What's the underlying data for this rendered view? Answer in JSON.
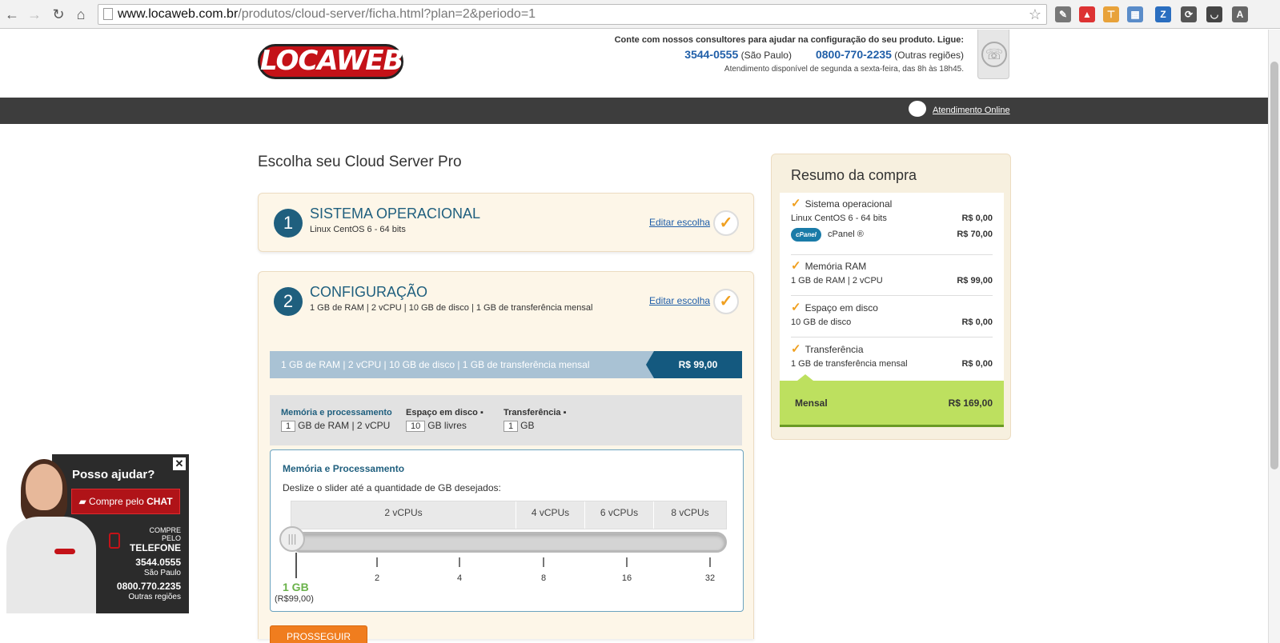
{
  "browser": {
    "url_host": "www.locaweb.com.br",
    "url_path": "/produtos/cloud-server/ficha.html?plan=2&periodo=1"
  },
  "header": {
    "logo": "LOCAWEB",
    "contact_lead": "Conte com nossos consultores para ajudar na configuração do seu produto. Ligue:",
    "phone1": "3544-0555",
    "phone1_region": "(São Paulo)",
    "phone2": "0800-770-2235",
    "phone2_region": "(Outras regiões)",
    "hours": "Atendimento disponível de segunda a sexta-feira, das 8h às 18h45."
  },
  "navbar": {
    "online_support": "Atendimento Online"
  },
  "main": {
    "page_title": "Escolha seu Cloud Server Pro",
    "steps": [
      {
        "num": "1",
        "title": "SISTEMA OPERACIONAL",
        "sub": "Linux CentOS 6 - 64 bits",
        "edit": "Editar escolha"
      },
      {
        "num": "2",
        "title": "CONFIGURAÇÃO",
        "sub": "1 GB de RAM | 2 vCPU | 10 GB de disco | 1 GB de transferência mensal",
        "edit": "Editar escolha"
      }
    ],
    "config_bar": {
      "text": "1 GB de RAM | 2 vCPU | 10 GB de disco | 1 GB de transferência mensal",
      "price": "R$ 99,00"
    },
    "tabs": [
      {
        "head": "Memória e processamento",
        "box": "1",
        "val": "GB de RAM | 2 vCPU"
      },
      {
        "head": "Espaço em disco",
        "box": "10",
        "val": "GB livres"
      },
      {
        "head": "Transferência",
        "box": "1",
        "val": "GB"
      }
    ],
    "memory": {
      "title": "Memória e Processamento",
      "instruction": "Deslize o slider até a quantidade de GB desejados:",
      "vcpus": [
        "2 vCPUs",
        "4 vCPUs",
        "6 vCPUs",
        "8 vCPUs"
      ],
      "ticks": [
        "2",
        "4",
        "8",
        "16",
        "32"
      ],
      "current_value": "1 GB",
      "current_price": "(R$99,00)",
      "slider_position": 0
    },
    "proceed": "PROSSEGUIR"
  },
  "summary": {
    "title": "Resumo da compra",
    "groups": [
      {
        "head": "Sistema operacional",
        "lines": [
          {
            "label": "Linux CentOS 6 - 64 bits",
            "price": "R$ 0,00"
          },
          {
            "label": "cPanel ®",
            "price": "R$ 70,00",
            "logo": "cPanel"
          }
        ]
      },
      {
        "head": "Memória RAM",
        "lines": [
          {
            "label": "1 GB de RAM | 2 vCPU",
            "price": "R$ 99,00"
          }
        ]
      },
      {
        "head": "Espaço em disco",
        "lines": [
          {
            "label": "10 GB de disco",
            "price": "R$ 0,00"
          }
        ]
      },
      {
        "head": "Transferência",
        "lines": [
          {
            "label": "1 GB de transferência mensal",
            "price": "R$ 0,00"
          }
        ]
      }
    ],
    "total_label": "Mensal",
    "total_value": "R$ 169,00"
  },
  "chat": {
    "heading": "Posso ajudar?",
    "cta_prefix": "Compre pelo",
    "cta_bold": "CHAT",
    "buy_by": "COMPRE PELO",
    "telefone": "TELEFONE",
    "num1": "3544.0555",
    "city1": "São Paulo",
    "num2": "0800.770.2235",
    "city2": "Outras regiões",
    "close": "✕"
  },
  "colors": {
    "brand_red": "#c41218",
    "step_blue": "#1f5f7e",
    "accent_orange": "#f07d1e",
    "total_green": "#bde05f"
  }
}
